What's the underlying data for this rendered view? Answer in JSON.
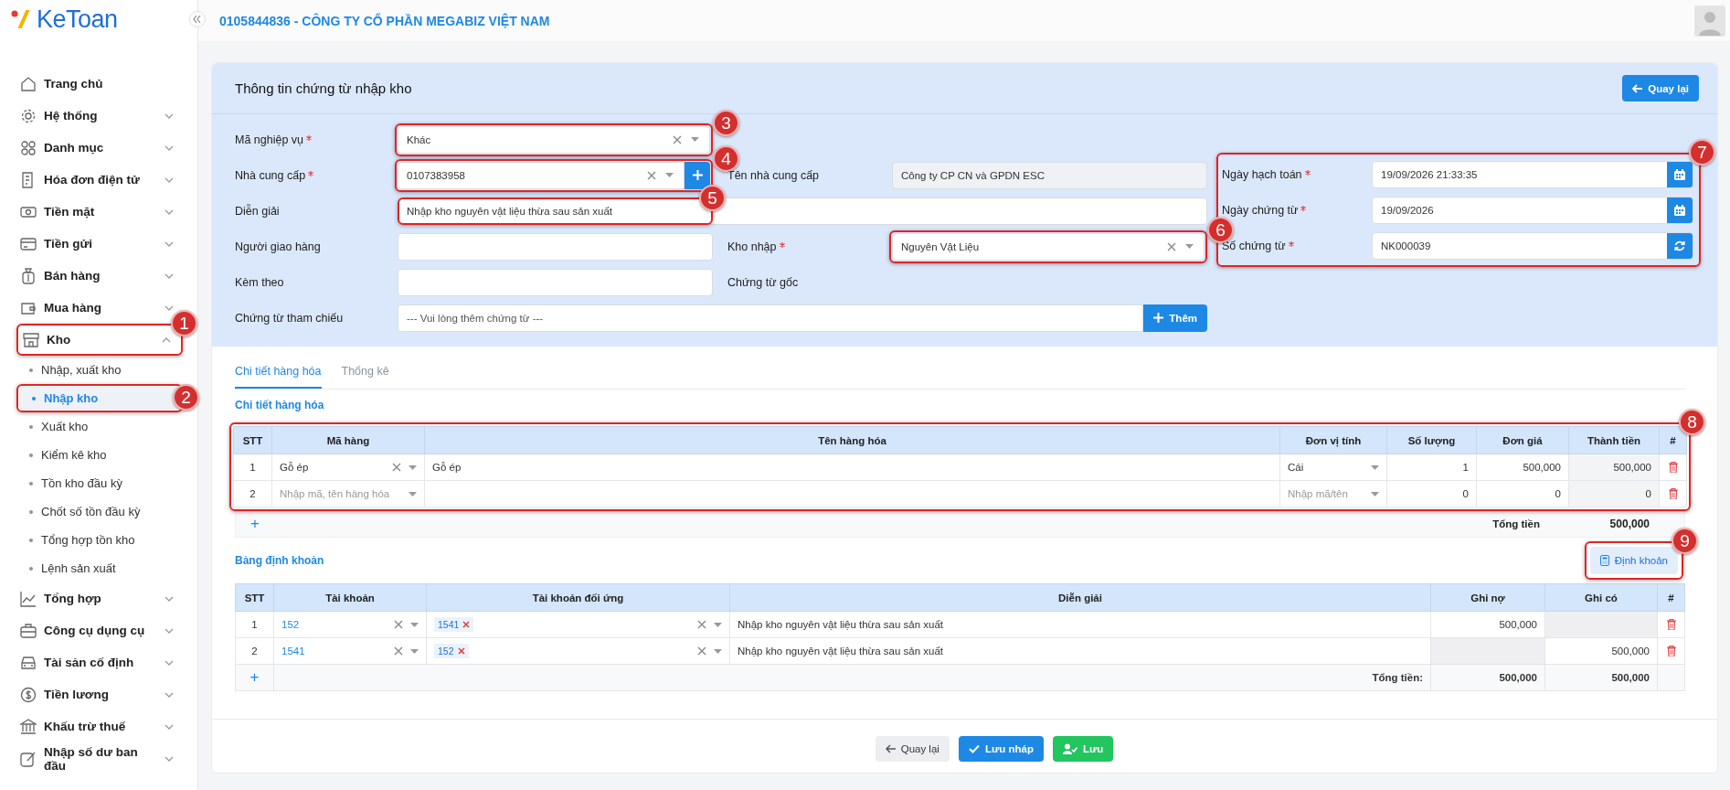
{
  "sidebar": {
    "logo": "KeToan",
    "items": [
      {
        "label": "Trang chủ",
        "expandable": false,
        "selected": false
      },
      {
        "label": "Hệ thống",
        "expandable": true,
        "expanded": false,
        "selected": false
      },
      {
        "label": "Danh mục",
        "expandable": true,
        "expanded": false,
        "selected": false
      },
      {
        "label": "Hóa đơn điện tử",
        "expandable": true,
        "expanded": false,
        "selected": false
      },
      {
        "label": "Tiền mặt",
        "expandable": true,
        "expanded": false,
        "selected": false
      },
      {
        "label": "Tiền gửi",
        "expandable": true,
        "expanded": false,
        "selected": false
      },
      {
        "label": "Bán hàng",
        "expandable": true,
        "expanded": false,
        "selected": false
      },
      {
        "label": "Mua hàng",
        "expandable": true,
        "expanded": false,
        "selected": false
      },
      {
        "label": "Kho",
        "expandable": true,
        "expanded": true,
        "selected": false,
        "callout": "1",
        "children": [
          {
            "label": "Nhập, xuất kho",
            "selected": false
          },
          {
            "label": "Nhập kho",
            "selected": true,
            "callout": "2"
          },
          {
            "label": "Xuất kho",
            "selected": false
          },
          {
            "label": "Kiểm kê kho",
            "selected": false
          },
          {
            "label": "Tồn kho đầu kỳ",
            "selected": false
          },
          {
            "label": "Chốt số tồn đầu kỳ",
            "selected": false
          },
          {
            "label": "Tổng hợp tồn kho",
            "selected": false
          },
          {
            "label": "Lệnh sản xuất",
            "selected": false
          }
        ]
      },
      {
        "label": "Tổng hợp",
        "expandable": true,
        "expanded": false,
        "selected": false
      },
      {
        "label": "Công cụ dụng cụ",
        "expandable": true,
        "expanded": false,
        "selected": false
      },
      {
        "label": "Tài sản cố định",
        "expandable": true,
        "expanded": false,
        "selected": false
      },
      {
        "label": "Tiền lương",
        "expandable": true,
        "expanded": false,
        "selected": false
      },
      {
        "label": "Khấu trừ thuế",
        "expandable": true,
        "expanded": false,
        "selected": false
      },
      {
        "label": "Nhập số dư ban đầu",
        "expandable": true,
        "expanded": false,
        "selected": false
      }
    ]
  },
  "header": {
    "company": "0105844836 - CÔNG TY CỔ PHẦN MEGABIZ VIỆT NAM"
  },
  "form": {
    "title": "Thông tin chứng từ nhập kho",
    "back_button": "Quay lại",
    "left_rows": [
      {
        "label": "Mã nghiệp vụ",
        "required": true,
        "field": {
          "kind": "select",
          "value": "Khác",
          "clearable": true,
          "callout": "3"
        }
      },
      {
        "label": "Nhà cung cấp",
        "required": true,
        "field": {
          "kind": "select",
          "value": "0107383958",
          "clearable": true,
          "addable": true,
          "callout": "4"
        },
        "label2": "Tên nhà cung cấp",
        "required2": false,
        "field2": {
          "kind": "readonly",
          "value": "Công ty CP CN và GPDN ESC"
        }
      },
      {
        "label": "Diễn giải",
        "required": false,
        "field": {
          "kind": "text",
          "value": "Nhập kho nguyên vật liệu thừa sau sản xuất",
          "wide": true,
          "callout": "5"
        }
      },
      {
        "label": "Người giao hàng",
        "required": false,
        "field": {
          "kind": "text"
        },
        "label2": "Kho nhập",
        "required2": true,
        "field2": {
          "kind": "select",
          "value": "Nguyên Vật Liệu",
          "clearable": true,
          "callout": "6"
        }
      },
      {
        "label": "Kèm theo",
        "required": false,
        "field": {
          "kind": "text"
        },
        "label2": "Chứng từ gốc",
        "required2": false
      },
      {
        "label": "Chứng từ tham chiếu",
        "required": false,
        "field": {
          "kind": "text",
          "placeholder": "--- Vui lòng thêm chứng từ ---",
          "wide": true,
          "button": "Thêm"
        }
      }
    ],
    "right": {
      "callout": "7",
      "rows": [
        {
          "label": "Ngày hạch toán",
          "required": true,
          "value": "19/09/2026 21:33:35",
          "kind": "date"
        },
        {
          "label": "Ngày chứng từ",
          "required": true,
          "value": "19/09/2026",
          "kind": "date"
        },
        {
          "label": "Số chứng từ",
          "required": true,
          "value": "NK000039",
          "kind": "code"
        }
      ]
    }
  },
  "tabs": [
    {
      "label": "Chi tiết hàng hóa",
      "selected": true
    },
    {
      "label": "Thống kê",
      "selected": false
    }
  ],
  "goods": {
    "title": "Chi tiết hàng hóa",
    "callout": "8",
    "columns": [
      "STT",
      "Mã hàng",
      "Tên hàng hóa",
      "Đơn vị tính",
      "Số lượng",
      "Đơn giá",
      "Thành tiền",
      "#"
    ],
    "rows": [
      {
        "stt": "1",
        "code": "Gỗ ép",
        "name": "Gỗ ép",
        "unit": "Cái",
        "qty": "1",
        "price": "500,000",
        "amount": "500,000"
      },
      {
        "stt": "2",
        "code_placeholder": "Nhập mã, tên hàng hóa",
        "unit_placeholder": "Nhập mã/tên",
        "qty": "0",
        "price": "0",
        "amount": "0"
      }
    ],
    "add": "+",
    "total_label": "Tổng tiền",
    "total": "500,000"
  },
  "entries": {
    "title": "Bảng định khoản",
    "button": "Định khoản",
    "button_callout": "9",
    "columns": [
      "STT",
      "Tài khoản",
      "Tài khoản đối ứng",
      "Diễn giải",
      "Ghi nợ",
      "Ghi có",
      "#"
    ],
    "rows": [
      {
        "stt": "1",
        "account": "152",
        "contra": [
          "1541"
        ],
        "description": "Nhập kho nguyên vật liệu thừa sau sản xuất",
        "debit": {
          "value": "500,000",
          "disabled": false
        },
        "credit": {
          "disabled": true
        }
      },
      {
        "stt": "2",
        "account": "1541",
        "contra": [
          "152"
        ],
        "description": "Nhập kho nguyên vật liệu thừa sau sản xuất",
        "debit": {
          "disabled": true
        },
        "credit": {
          "value": "500,000",
          "disabled": false
        }
      }
    ],
    "add": "+",
    "total_label": "Tổng tiền:",
    "total_debit": "500,000",
    "total_credit": "500,000"
  },
  "footer_buttons": [
    {
      "label": "Quay lại",
      "kind": "back"
    },
    {
      "label": "Lưu nháp",
      "kind": "draft"
    },
    {
      "label": "Lưu",
      "kind": "save"
    }
  ]
}
